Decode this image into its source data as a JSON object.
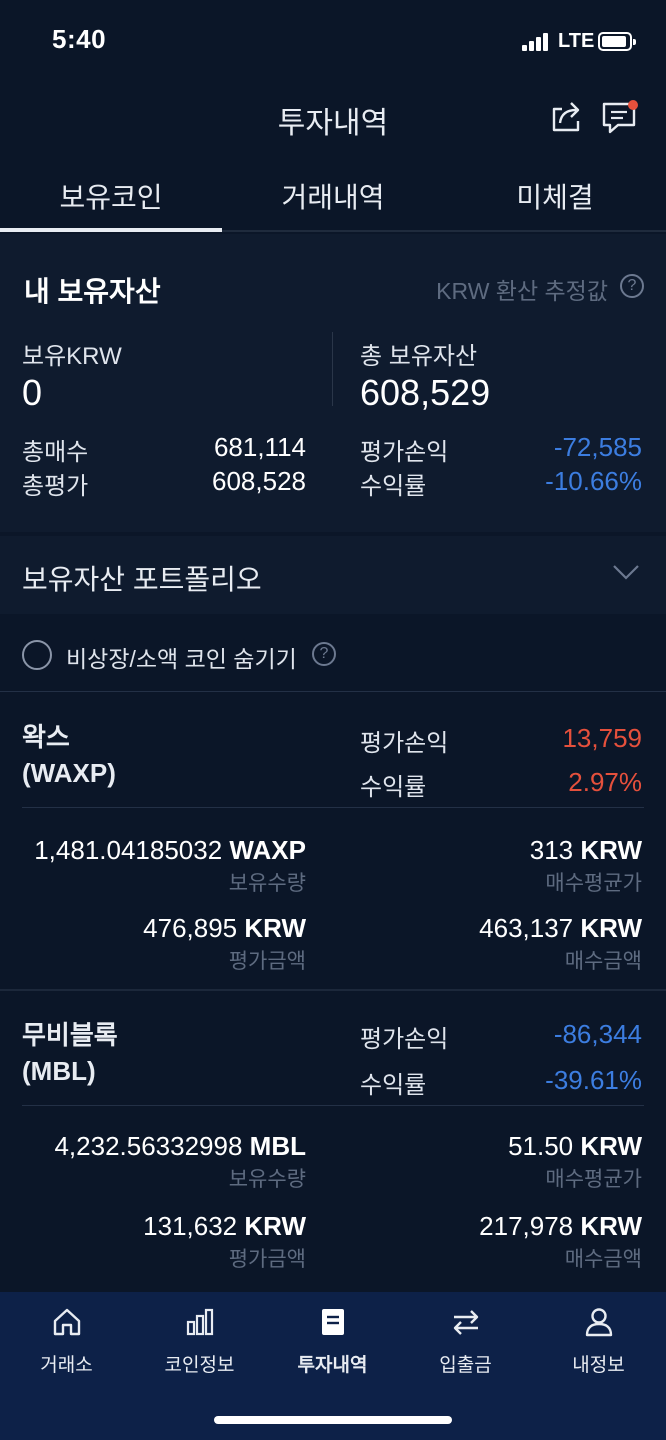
{
  "status": {
    "time": "5:40",
    "network": "LTE"
  },
  "header": {
    "title": "투자내역"
  },
  "tabs": [
    {
      "label": "보유코인"
    },
    {
      "label": "거래내역"
    },
    {
      "label": "미체결"
    }
  ],
  "summary": {
    "title": "내 보유자산",
    "krw_note": "KRW 환산 추정값",
    "krw_label": "보유KRW",
    "krw_value": "0",
    "total_label": "총 보유자산",
    "total_value": "608,529",
    "buy_label": "총매수",
    "buy_value": "681,114",
    "eval_label": "총평가",
    "eval_value": "608,528",
    "pnl_label": "평가손익",
    "pnl_value": "-72,585",
    "rate_label": "수익률",
    "rate_value": "-10.66%"
  },
  "portfolio": {
    "label": "보유자산 포트폴리오"
  },
  "hide_option": {
    "label": "비상장/소액 코인 숨기기"
  },
  "coins": [
    {
      "name": "왁스",
      "symbol": "(WAXP)",
      "pnl_label": "평가손익",
      "pnl_value": "13,759",
      "rate_label": "수익률",
      "rate_value": "2.97%",
      "qty_number": "1,481.04185032",
      "qty_unit": "WAXP",
      "qty_label": "보유수량",
      "avg_number": "313",
      "avg_unit": "KRW",
      "avg_label": "매수평균가",
      "eval_number": "476,895",
      "eval_unit": "KRW",
      "eval_label": "평가금액",
      "buy_number": "463,137",
      "buy_unit": "KRW",
      "buy_label": "매수금액"
    },
    {
      "name": "무비블록",
      "symbol": "(MBL)",
      "pnl_label": "평가손익",
      "pnl_value": "-86,344",
      "rate_label": "수익률",
      "rate_value": "-39.61%",
      "qty_number": "4,232.56332998",
      "qty_unit": "MBL",
      "qty_label": "보유수량",
      "avg_number": "51.50",
      "avg_unit": "KRW",
      "avg_label": "매수평균가",
      "eval_number": "131,632",
      "eval_unit": "KRW",
      "eval_label": "평가금액",
      "buy_number": "217,978",
      "buy_unit": "KRW",
      "buy_label": "매수금액"
    }
  ],
  "nav": [
    {
      "label": "거래소",
      "icon": "home-icon"
    },
    {
      "label": "코인정보",
      "icon": "chart-bars-icon"
    },
    {
      "label": "투자내역",
      "icon": "document-icon",
      "active": true
    },
    {
      "label": "입출금",
      "icon": "transfer-arrows-icon"
    },
    {
      "label": "내정보",
      "icon": "person-icon"
    }
  ],
  "colors": {
    "background": "#0b1628",
    "panel": "#0f1b2e",
    "positive": "#e5503c",
    "negative": "#3c7de0",
    "nav": "#0d2148"
  }
}
